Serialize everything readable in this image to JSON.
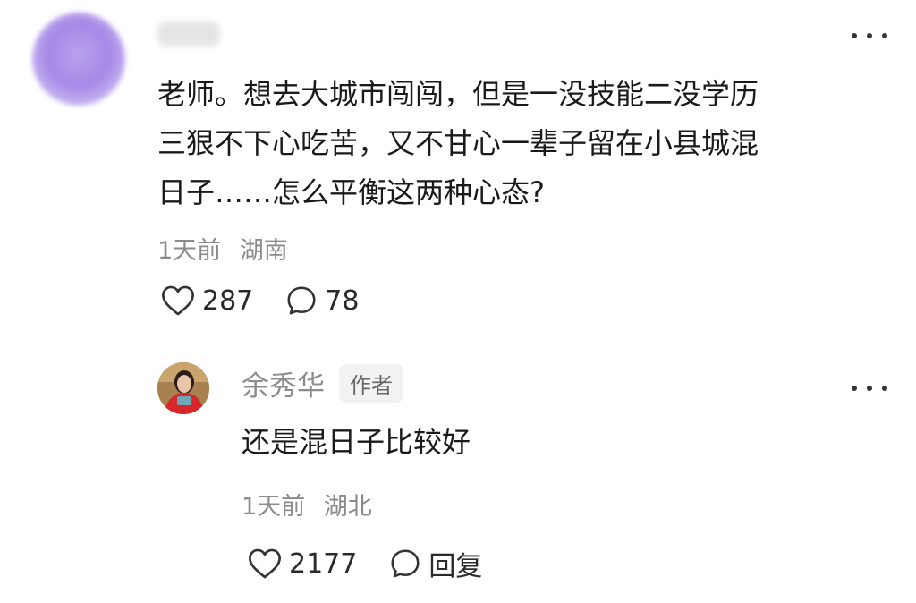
{
  "comment": {
    "text": "老师。想去大城市闯闯，但是一没技能二没学历\n三狠不下心吃苦，又不甘心一辈子留在小县城混\n日子……怎么平衡这两种心态?",
    "time": "1天前",
    "location": "湖南",
    "likes": "287",
    "replies": "78"
  },
  "reply": {
    "author": "余秀华",
    "badge": "作者",
    "text": "还是混日子比较好",
    "time": "1天前",
    "location": "湖北",
    "likes": "2177",
    "reply_label": "回复"
  },
  "icons": {
    "like": "heart-outline-icon",
    "comment": "speech-bubble-icon",
    "more": "ellipsis-icon"
  },
  "colors": {
    "text_primary": "#1a1a1a",
    "text_secondary": "#8a8a8a",
    "badge_bg": "#f2f2f2"
  }
}
